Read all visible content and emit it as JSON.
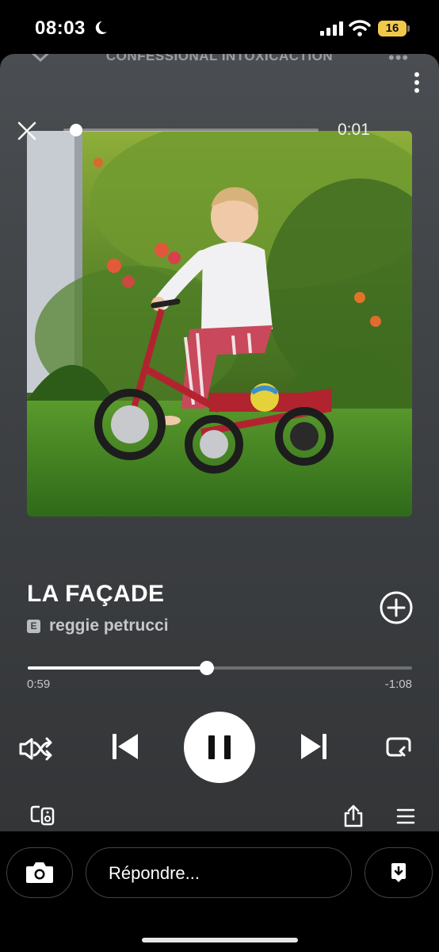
{
  "status_bar": {
    "time": "08:03",
    "battery_level": "16",
    "battery_color": "#f2c84b"
  },
  "player": {
    "playlist_name": "CONFESSIONAL INTOXICACTION",
    "video_time": "0:01",
    "video_progress_fraction": 0.05,
    "track": {
      "title": "LA FAÇADE",
      "explicit_badge": "E",
      "artist": "reggie petrucci"
    },
    "progress": {
      "elapsed": "0:59",
      "remaining": "-1:08",
      "fraction": 0.465
    },
    "controls": {
      "shuffle": "shuffle-icon",
      "previous": "skip-back-icon",
      "pause": "pause-icon",
      "next": "skip-forward-icon",
      "repeat": "repeat-icon"
    },
    "footer_icons": [
      "devices-icon",
      "share-icon",
      "queue-icon"
    ]
  },
  "reply_bar": {
    "placeholder": "Répondre..."
  },
  "colors": {
    "background_top": "#4a4d51",
    "background_bottom": "#333537",
    "accent": "#ffffff"
  }
}
